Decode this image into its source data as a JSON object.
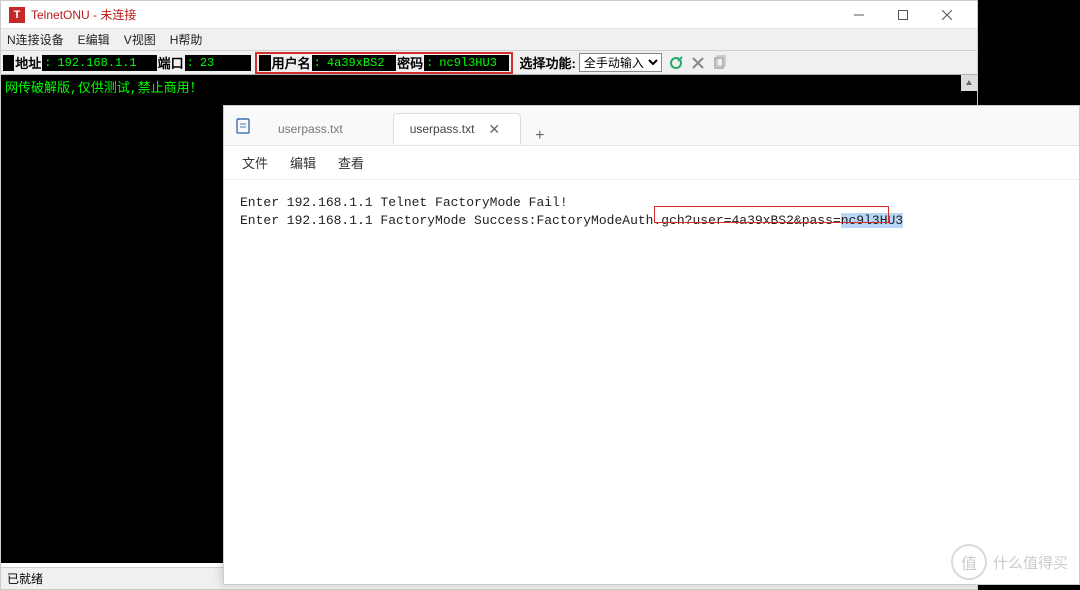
{
  "telnet": {
    "app_icon_letter": "T",
    "title": "TelnetONU - 未连接",
    "menu": {
      "connect": "N连接设备",
      "edit": "E编辑",
      "view": "V视图",
      "help": "H帮助"
    },
    "toolbar": {
      "addr_label": "地址",
      "addr_value": "192.168.1.1",
      "port_label": "端口",
      "port_value": "23",
      "user_label": "用户名",
      "user_value": "4a39xBS2",
      "pass_label": "密码",
      "pass_value": "nc9l3HU3",
      "func_label": "选择功能:",
      "func_value": "全手动输入",
      "colon": ":"
    },
    "terminal_line": "网传破解版,仅供测试,禁止商用！",
    "status": "已就绪"
  },
  "notepad": {
    "tab_inactive": "userpass.txt",
    "tab_active": "userpass.txt",
    "menu": {
      "file": "文件",
      "edit": "编辑",
      "view": "查看"
    },
    "content": {
      "line1": "Enter 192.168.1.1 Telnet FactoryMode Fail!",
      "line2_a": "Enter 192.168.1.1 FactoryMode Success:FactoryModeAuth.gch?user=4a39xBS2&pass=",
      "line2_sel": "nc9l3HU3"
    }
  },
  "watermark": {
    "circle": "值",
    "text": "什么值得买"
  }
}
